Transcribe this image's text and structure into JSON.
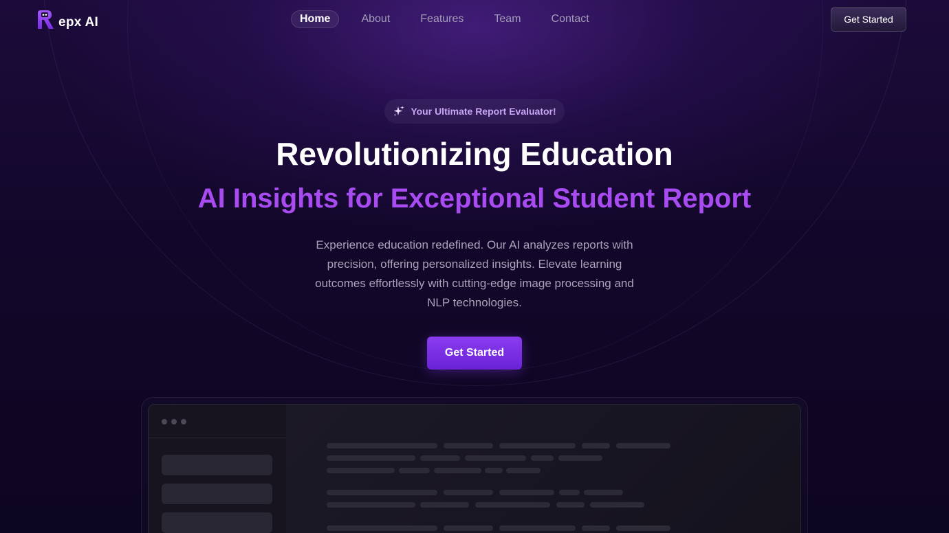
{
  "brand": {
    "name": "epx AI"
  },
  "nav": {
    "items": [
      {
        "label": "Home",
        "active": true
      },
      {
        "label": "About",
        "active": false
      },
      {
        "label": "Features",
        "active": false
      },
      {
        "label": "Team",
        "active": false
      },
      {
        "label": "Contact",
        "active": false
      }
    ]
  },
  "header": {
    "cta_label": "Get Started"
  },
  "hero": {
    "badge_icon": "sparkles-icon",
    "badge_text": "Your Ultimate Report Evaluator!",
    "title": "Revolutionizing Education",
    "subtitle": "AI Insights for Exceptional Student Report",
    "description": "Experience education redefined. Our AI analyzes reports with precision, offering personalized insights. Elevate learning outcomes effortlessly with cutting-edge image processing and NLP technologies.",
    "cta_label": "Get Started"
  },
  "colors": {
    "accent": "#a84bf0",
    "button": "#7b2fe6",
    "background": "#12072a"
  }
}
